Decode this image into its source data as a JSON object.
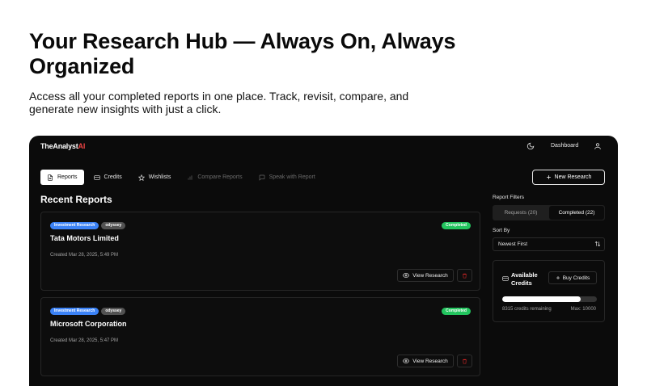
{
  "hero": {
    "title": "Your Research Hub — Always On, Always Organized",
    "subtitle": "Access all your completed reports in one place. Track, revisit, compare, and generate new insights with just a click."
  },
  "app": {
    "logo_main": "TheAnalyst",
    "logo_accent": "AI",
    "nav": {
      "dashboard": "Dashboard"
    },
    "tabs": [
      {
        "label": "Reports",
        "icon": "file-icon",
        "active": true
      },
      {
        "label": "Credits",
        "icon": "card-icon"
      },
      {
        "label": "Wishlists",
        "icon": "star-icon"
      },
      {
        "label": "Compare Reports",
        "icon": "chart-icon",
        "disabled": true
      },
      {
        "label": "Speak with Report",
        "icon": "chat-icon",
        "disabled": true
      }
    ],
    "new_research_label": "New Research",
    "section_title": "Recent Reports",
    "reports": [
      {
        "tags": [
          "Investment Research",
          "odyssey"
        ],
        "status": "Completed",
        "title": "Tata Motors Limited",
        "created": "Created Mar 28, 2025, 5:49 PM",
        "view_label": "View Research"
      },
      {
        "tags": [
          "Investment Research",
          "odyssey"
        ],
        "status": "Completed",
        "title": "Microsoft Corporation",
        "created": "Created Mar 28, 2025, 5:47 PM",
        "view_label": "View Research"
      }
    ],
    "filters": {
      "label": "Report Filters",
      "options": [
        "Requests (20)",
        "Completed (22)"
      ],
      "selected": "Completed (22)",
      "sort_label": "Sort By",
      "sort_value": "Newest First"
    },
    "credits": {
      "title": "Available Credits",
      "buy_label": "Buy Credits",
      "remaining_text": "8315 credits remaining",
      "max_text": "Max: 10000",
      "remaining": 8315,
      "max": 10000
    },
    "colors": {
      "accent": "#ef4444",
      "tag_blue": "#3b82f6",
      "status_green": "#22c55e"
    }
  }
}
